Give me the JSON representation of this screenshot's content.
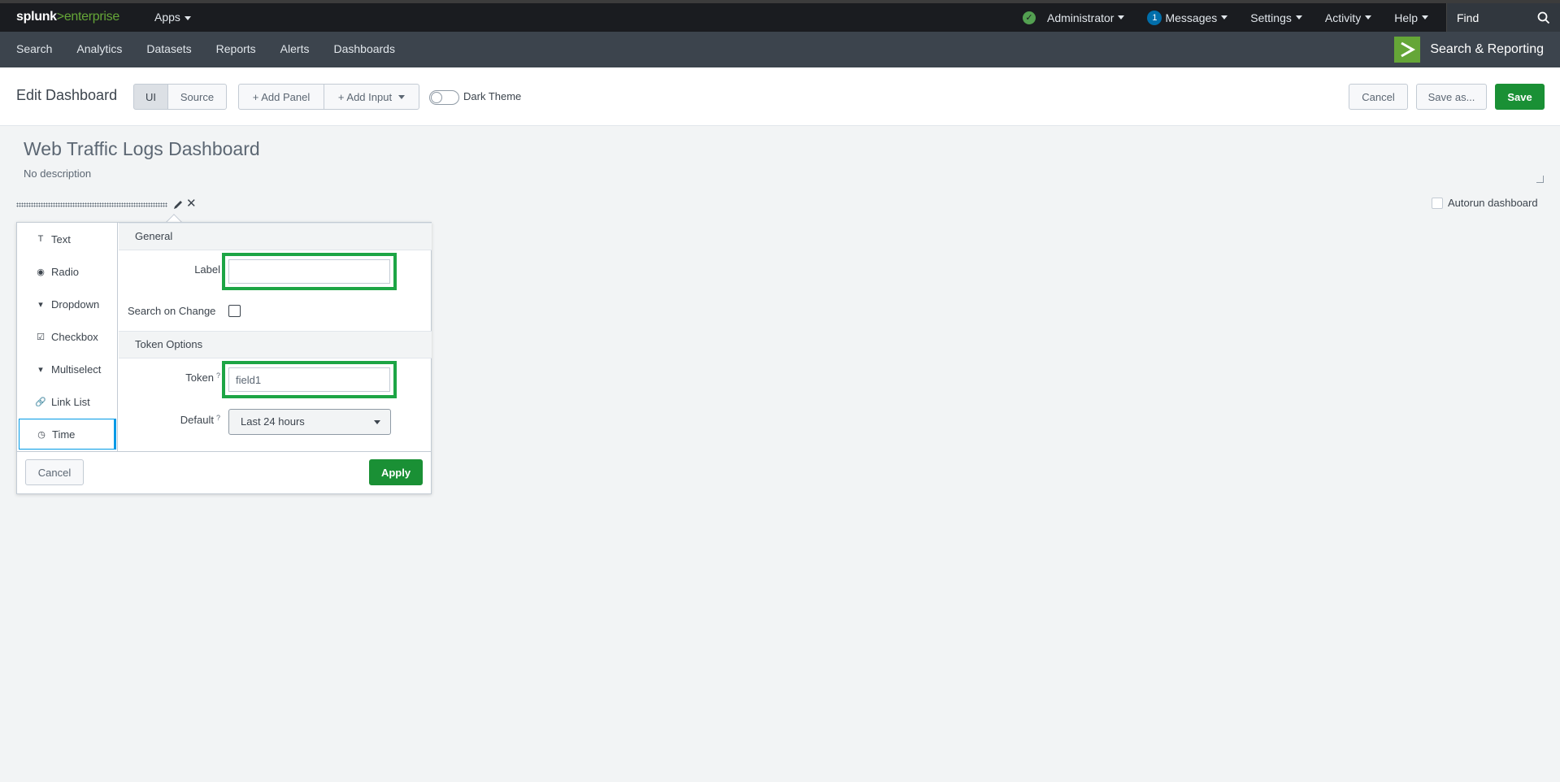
{
  "topbar": {
    "logo_main": "splunk",
    "logo_sep": ">",
    "logo_product": "enterprise",
    "apps": "Apps",
    "user": "Administrator",
    "messages_count": "1",
    "messages": "Messages",
    "settings": "Settings",
    "activity": "Activity",
    "help": "Help",
    "find": "Find"
  },
  "appbar": {
    "nav": [
      "Search",
      "Analytics",
      "Datasets",
      "Reports",
      "Alerts",
      "Dashboards"
    ],
    "app_name": "Search & Reporting"
  },
  "editbar": {
    "title": "Edit Dashboard",
    "ui": "UI",
    "source": "Source",
    "add_panel": "+ Add Panel",
    "add_input": "+ Add Input",
    "dark_theme": "Dark Theme",
    "cancel": "Cancel",
    "save_as": "Save as...",
    "save": "Save"
  },
  "dashboard": {
    "title": "Web Traffic Logs Dashboard",
    "description": "No description",
    "autorun": "Autorun dashboard"
  },
  "editor": {
    "types": [
      {
        "label": "Text",
        "icon": "T"
      },
      {
        "label": "Radio",
        "icon": "◉"
      },
      {
        "label": "Dropdown",
        "icon": "▾"
      },
      {
        "label": "Checkbox",
        "icon": "☑"
      },
      {
        "label": "Multiselect",
        "icon": "▾"
      },
      {
        "label": "Link List",
        "icon": "🔗"
      },
      {
        "label": "Time",
        "icon": "◷"
      }
    ],
    "general": "General",
    "label": "Label",
    "label_value": "",
    "search_on_change": "Search on Change",
    "token_options": "Token Options",
    "token": "Token",
    "help": "?",
    "token_value": "field1",
    "default": "Default",
    "default_value": "Last 24 hours",
    "cancel": "Cancel",
    "apply": "Apply"
  },
  "colors": {
    "accent_green": "#1a9035",
    "highlight_green": "#1da545",
    "selection_blue": "#009ae6"
  }
}
